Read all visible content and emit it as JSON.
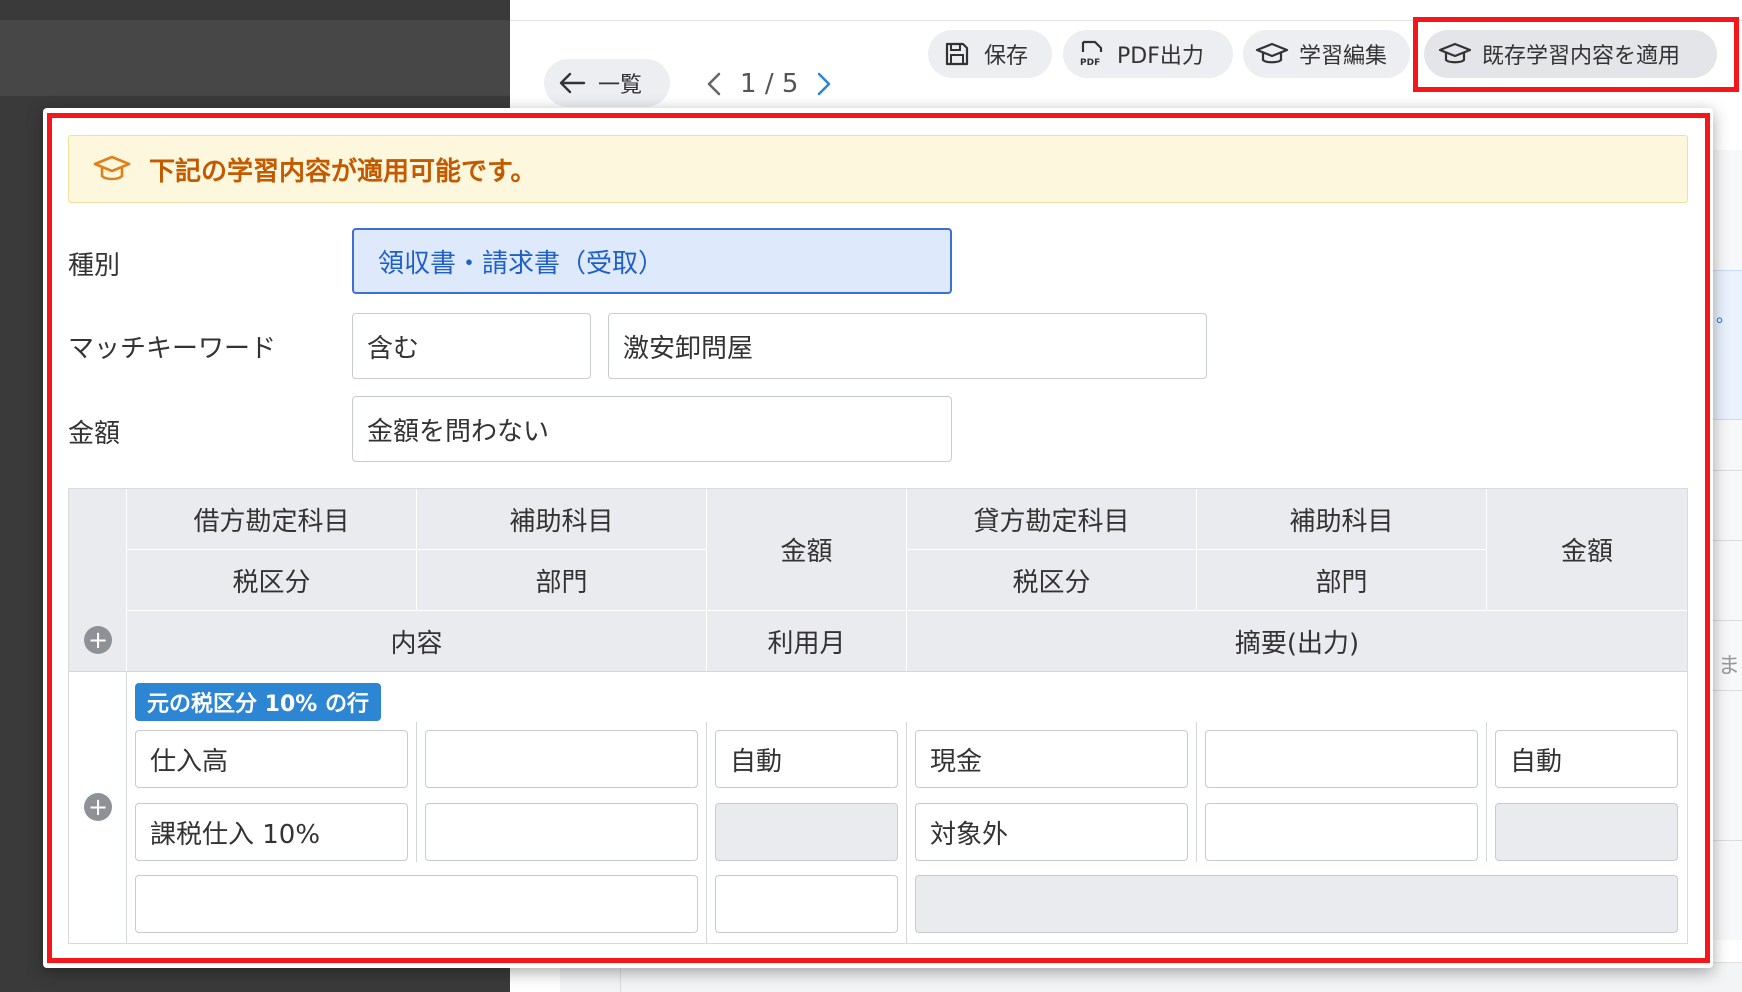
{
  "toolbar": {
    "back_label": "一覧",
    "pager_current": "1",
    "pager_sep": "/",
    "pager_total": "5",
    "save_label": "保存",
    "pdf_label": "PDF出力",
    "edit_learning_label": "学習編集",
    "apply_learning_label": "既存学習内容を適用"
  },
  "background": {
    "partial_text": "ま",
    "partial_dot": "。"
  },
  "panel": {
    "notice": "下記の学習内容が適用可能です。",
    "type_label": "種別",
    "type_value": "領収書・請求書（受取）",
    "keyword_label": "マッチキーワード",
    "keyword_condition": "含む",
    "keyword_value": "激安卸問屋",
    "amount_label": "金額",
    "amount_value": "金額を問わない",
    "table": {
      "headers": {
        "debit_account": "借方勘定科目",
        "debit_sub": "補助科目",
        "debit_tax": "税区分",
        "debit_dept": "部門",
        "debit_amount": "金額",
        "credit_account": "貸方勘定科目",
        "credit_sub": "補助科目",
        "credit_tax": "税区分",
        "credit_dept": "部門",
        "credit_amount": "金額",
        "content": "内容",
        "usage_month": "利用月",
        "summary": "摘要(出力)"
      },
      "row_badge": "元の税区分 10% の行",
      "row": {
        "debit_account": "仕入高",
        "debit_sub": "",
        "debit_amount": "自動",
        "credit_account": "現金",
        "credit_sub": "",
        "credit_amount": "自動",
        "debit_tax": "課税仕入 10%",
        "debit_dept": "",
        "credit_tax": "対象外",
        "credit_dept": "",
        "content": "",
        "usage_month": "",
        "summary": ""
      }
    }
  },
  "colors": {
    "accent": "#f5161b",
    "notice_text": "#c35a00",
    "badge": "#2d86d3",
    "selected": "#1f5fc8"
  }
}
